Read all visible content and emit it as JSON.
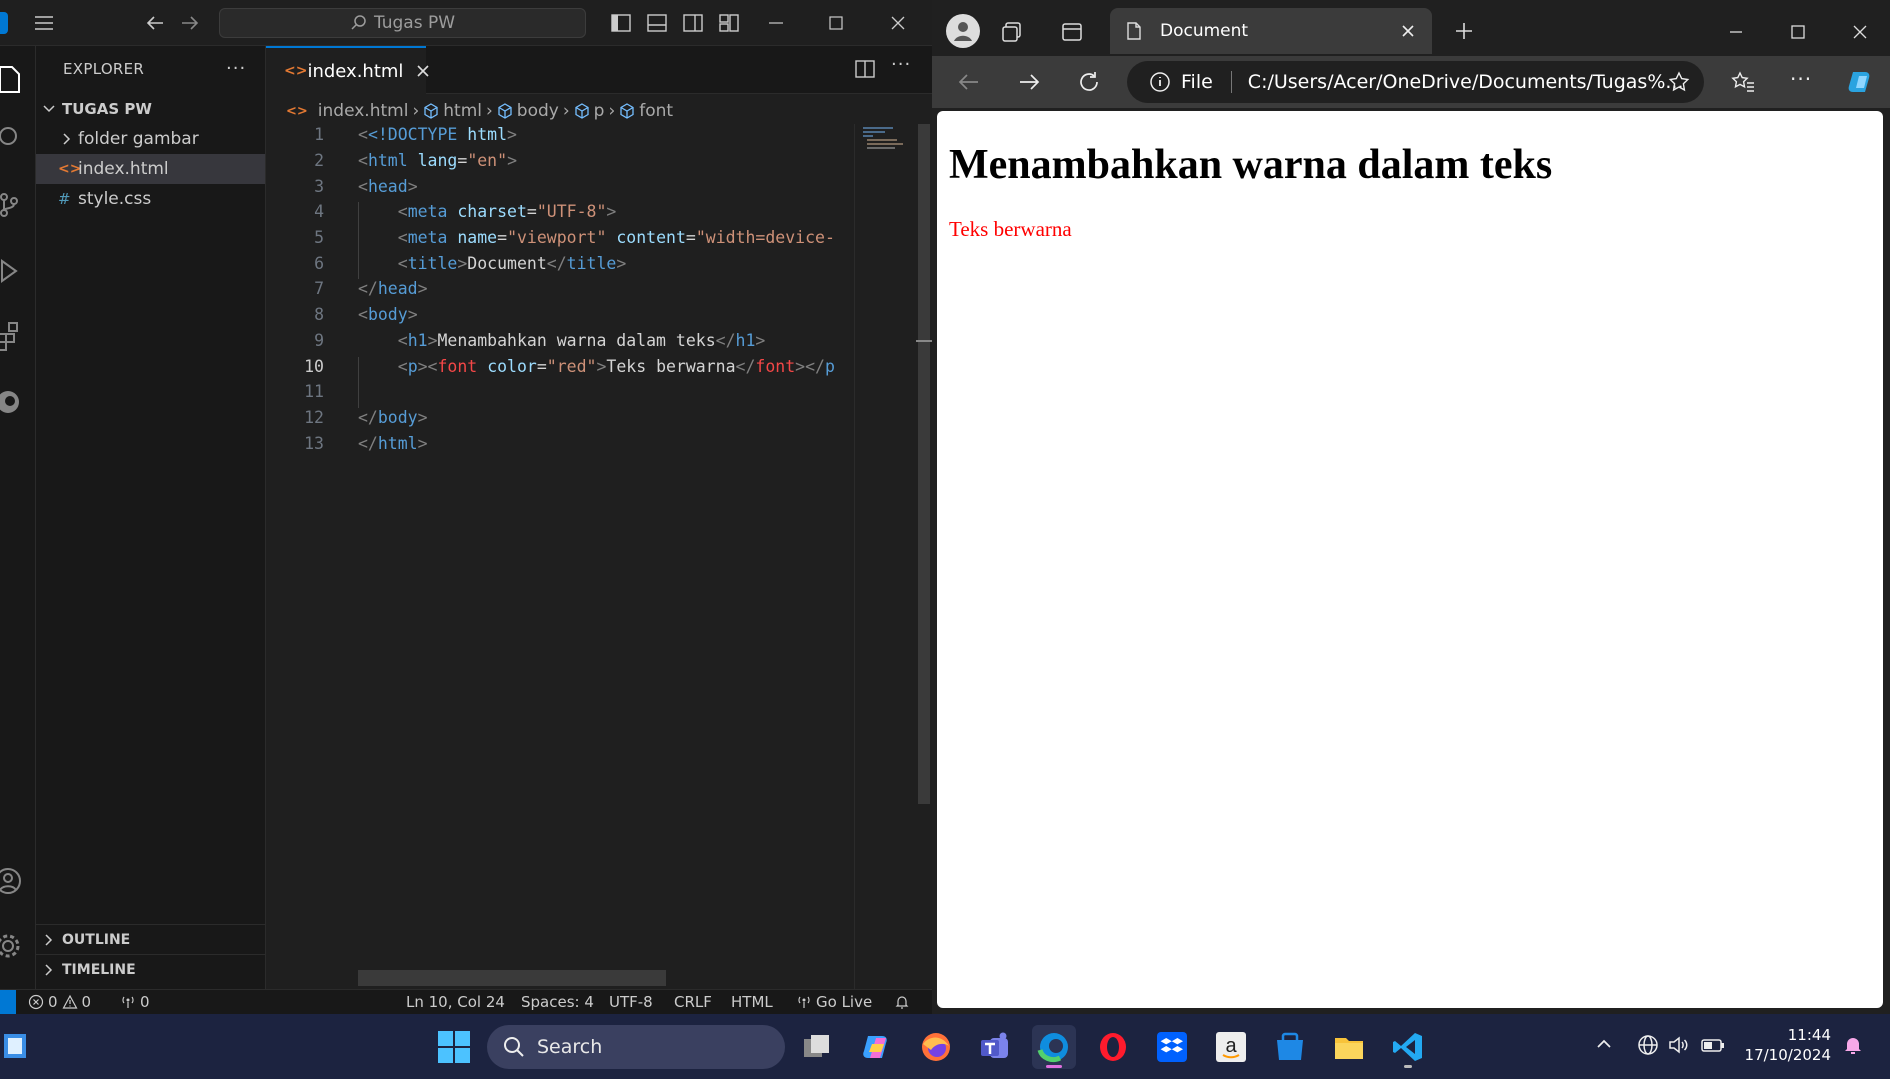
{
  "vscode": {
    "command_center": "Tugas PW",
    "explorer_title": "EXPLORER",
    "folder_name": "TUGAS PW",
    "tree": [
      {
        "label": "folder gambar",
        "kind": "folder"
      },
      {
        "label": "index.html",
        "kind": "html"
      },
      {
        "label": "style.css",
        "kind": "css"
      }
    ],
    "outline_label": "OUTLINE",
    "timeline_label": "TIMELINE",
    "tab_label": "index.html",
    "breadcrumb": [
      "index.html",
      "html",
      "body",
      "p",
      "font"
    ],
    "line_numbers": [
      "1",
      "2",
      "3",
      "4",
      "5",
      "6",
      "7",
      "8",
      "9",
      "10",
      "11",
      "12",
      "13"
    ],
    "code": {
      "doctype_open": "<!DOCTYPE ",
      "doctype_kw": "html",
      "html_tag": "html",
      "lang_attr": "lang",
      "lang_val": "\"en\"",
      "head_tag": "head",
      "meta_tag": "meta",
      "charset_attr": "charset",
      "charset_val": "\"UTF-8\"",
      "name_attr": "name",
      "name_val": "\"viewport\"",
      "content_attr": "content",
      "content_val": "\"width=device-",
      "title_tag": "title",
      "title_text": "Document",
      "body_tag": "body",
      "h1_tag": "h1",
      "h1_text": "Menambahkan warna dalam teks",
      "p_tag": "p",
      "font_tag": "font",
      "color_attr": "color",
      "color_val": "\"red\"",
      "font_text": "Teks berwarna",
      "p_trunc": "p"
    },
    "status": {
      "errors": "0",
      "warnings": "0",
      "ports": "0",
      "position": "Ln 10, Col 24",
      "spaces": "Spaces: 4",
      "encoding": "UTF-8",
      "eol": "CRLF",
      "language": "HTML",
      "golive": "Go Live"
    }
  },
  "browser": {
    "tab_title": "Document",
    "address_scheme": "File",
    "address_url": "C:/Users/Acer/OneDrive/Documents/Tugas%...",
    "page_heading": "Menambahkan warna dalam teks",
    "page_text": "Teks berwarna",
    "page_text_color": "#ff0000"
  },
  "taskbar": {
    "search_label": "Search",
    "time": "11:44",
    "date": "17/10/2024"
  },
  "colors": {
    "accent": "#0078d4",
    "tag": "#569cd6",
    "attr": "#9cdcfe",
    "string": "#ce9178"
  }
}
